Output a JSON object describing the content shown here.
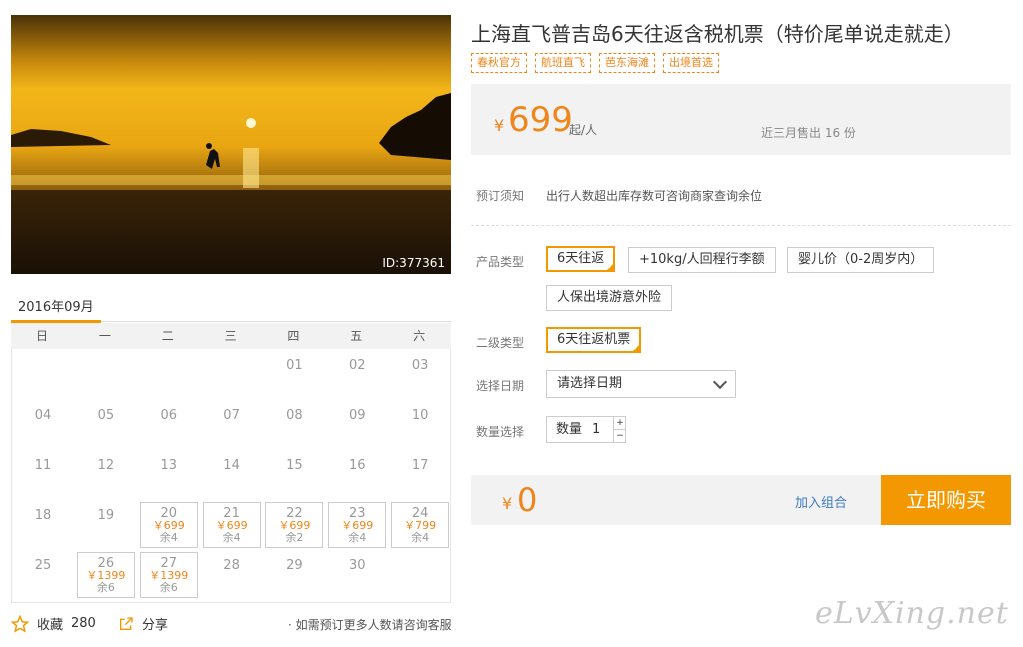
{
  "photo": {
    "id_label": "ID:377361"
  },
  "calendar": {
    "month": "2016年09月",
    "weekdays": [
      "日",
      "一",
      "二",
      "三",
      "四",
      "五",
      "六"
    ],
    "days": [
      {
        "d": "01"
      },
      {
        "d": "02"
      },
      {
        "d": "03"
      },
      {
        "d": "04"
      },
      {
        "d": "05"
      },
      {
        "d": "06"
      },
      {
        "d": "07"
      },
      {
        "d": "08"
      },
      {
        "d": "09"
      },
      {
        "d": "10"
      },
      {
        "d": "11"
      },
      {
        "d": "12"
      },
      {
        "d": "13"
      },
      {
        "d": "14"
      },
      {
        "d": "15"
      },
      {
        "d": "16"
      },
      {
        "d": "17"
      },
      {
        "d": "18"
      },
      {
        "d": "19"
      },
      {
        "d": "20",
        "price": "￥699",
        "left": "余4"
      },
      {
        "d": "21",
        "price": "￥699",
        "left": "余4"
      },
      {
        "d": "22",
        "price": "￥699",
        "left": "余2"
      },
      {
        "d": "23",
        "price": "￥699",
        "left": "余4"
      },
      {
        "d": "24",
        "price": "￥799",
        "left": "余4"
      },
      {
        "d": "25"
      },
      {
        "d": "26",
        "price": "￥1399",
        "left": "余6"
      },
      {
        "d": "27",
        "price": "￥1399",
        "left": "余6"
      },
      {
        "d": "28"
      },
      {
        "d": "29"
      },
      {
        "d": "30"
      }
    ]
  },
  "actions": {
    "favorite_label": "收藏",
    "favorite_count": "280",
    "share_label": "分享",
    "note": "· 如需预订更多人数请咨询客服"
  },
  "product": {
    "title": "上海直飞普吉岛6天往返含税机票（特价尾单说走就走）",
    "tags": [
      "春秋官方",
      "航班直飞",
      "芭东海滩",
      "出境首选"
    ],
    "currency": "¥",
    "price": "699",
    "price_unit": "起/人",
    "sold": "近三月售出 16 份",
    "booking_label": "预订须知",
    "booking_text": "出行人数超出库存数可咨询商家查询余位",
    "type_label": "产品类型",
    "type_options": [
      "6天往返",
      "+10kg/人回程行李额",
      "婴儿价（0-2周岁内）",
      "人保出境游意外险"
    ],
    "subtype_label": "二级类型",
    "subtype_option": "6天往返机票",
    "date_label": "选择日期",
    "date_placeholder": "请选择日期",
    "qty_label": "数量选择",
    "qty_prefix": "数量",
    "qty_value": "1",
    "total_currency": "¥",
    "total": "0",
    "add_combo": "加入组合",
    "buy": "立即购买"
  },
  "watermark": "eLvXing.net",
  "colors": {
    "accent": "#f39800",
    "price": "#f08519",
    "link": "#3b7cc4"
  }
}
